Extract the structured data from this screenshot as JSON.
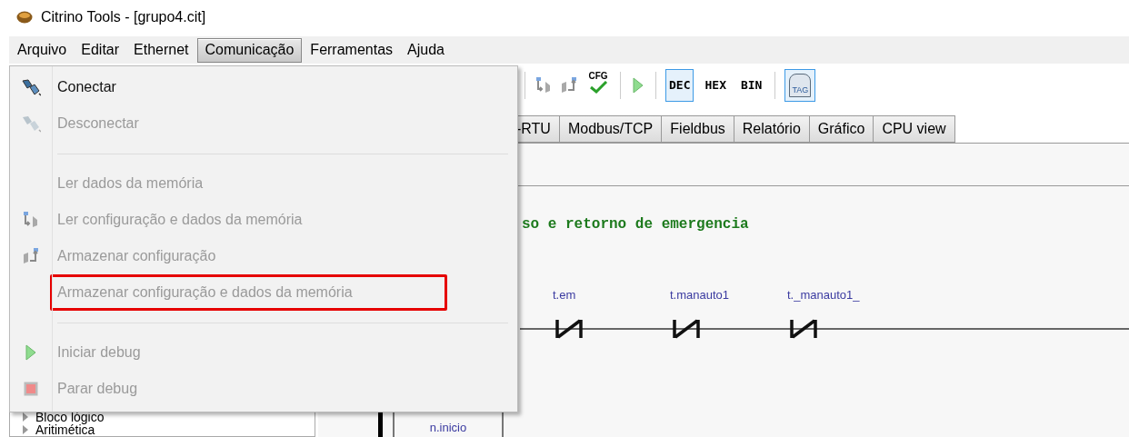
{
  "window": {
    "title": "Citrino Tools - [grupo4.cit]"
  },
  "menubar": [
    {
      "label": "Arquivo",
      "selected": false
    },
    {
      "label": "Editar",
      "selected": false
    },
    {
      "label": "Ethernet",
      "selected": false
    },
    {
      "label": "Comunicação",
      "selected": true
    },
    {
      "label": "Ferramentas",
      "selected": false
    },
    {
      "label": "Ajuda",
      "selected": false
    }
  ],
  "menu": [
    {
      "kind": "connect",
      "label": "Conectar",
      "disabled": false,
      "highlighted": false
    },
    {
      "kind": "disconnect",
      "label": "Desconectar",
      "disabled": true,
      "highlighted": false
    },
    {
      "kind": "separator"
    },
    {
      "kind": "plain",
      "label": "Ler dados da memória",
      "disabled": true,
      "highlighted": false
    },
    {
      "kind": "read",
      "label": "Ler configuração e dados da memória",
      "disabled": true,
      "highlighted": false
    },
    {
      "kind": "store",
      "label": "Armazenar configuração",
      "disabled": true,
      "highlighted": false
    },
    {
      "kind": "plain",
      "label": "Armazenar configuração e dados da memória",
      "disabled": true,
      "highlighted": true
    },
    {
      "kind": "separator"
    },
    {
      "kind": "play",
      "label": "Iniciar debug",
      "disabled": true,
      "highlighted": false
    },
    {
      "kind": "stop",
      "label": "Parar debug",
      "disabled": true,
      "highlighted": false
    }
  ],
  "toolbar": [
    {
      "kind": "separator"
    },
    {
      "kind": "read"
    },
    {
      "kind": "store"
    },
    {
      "kind": "cfg",
      "label": "CFG"
    },
    {
      "kind": "separator"
    },
    {
      "kind": "play"
    },
    {
      "kind": "separator"
    },
    {
      "kind": "toggle",
      "label": "DEC",
      "selected": true
    },
    {
      "kind": "toggle",
      "label": "HEX",
      "selected": false
    },
    {
      "kind": "toggle",
      "label": "BIN",
      "selected": false
    },
    {
      "kind": "separator"
    },
    {
      "kind": "tag",
      "label": "TAG",
      "selected": true
    }
  ],
  "tabs": [
    {
      "label": "-RTU",
      "selected": false
    },
    {
      "label": "Modbus/TCP",
      "selected": false
    },
    {
      "label": "Fieldbus",
      "selected": false
    },
    {
      "label": "Relatório",
      "selected": false
    },
    {
      "label": "Gráfico",
      "selected": false
    },
    {
      "label": "CPU view",
      "selected": false
    }
  ],
  "tree": [
    {
      "label": "Bloco lógico",
      "expanded": false
    },
    {
      "label": "Aritimética",
      "expanded": false
    }
  ],
  "ladder": {
    "comment": "so e retorno de emergencia",
    "contacts": [
      {
        "label": "t.em",
        "kind": "normally_closed"
      },
      {
        "label": "t.manauto1",
        "kind": "normally_closed"
      },
      {
        "label": "t._manauto1_",
        "kind": "normally_closed"
      }
    ],
    "block": {
      "label": "n.inicio"
    }
  }
}
